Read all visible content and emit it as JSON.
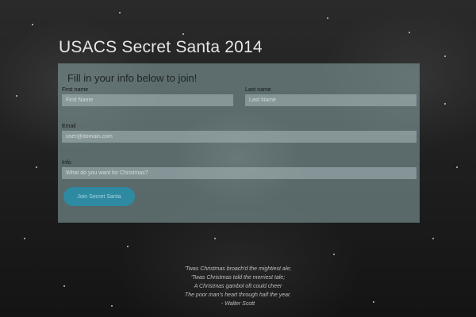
{
  "page": {
    "title": "USACS Secret Santa 2014"
  },
  "form": {
    "heading": "Fill in your info below to join!",
    "first_name": {
      "label": "First name",
      "placeholder": "First Name",
      "value": ""
    },
    "last_name": {
      "label": "Last name",
      "placeholder": "Last Name",
      "value": ""
    },
    "email": {
      "label": "Email",
      "placeholder": "user@domain.com",
      "value": ""
    },
    "info": {
      "label": "Info",
      "placeholder": "What do you want for Christmas?",
      "value": ""
    },
    "submit_label": "Join Secret Santa"
  },
  "quote": {
    "lines": [
      "'Twas Christmas broach'd the mightiest ale;",
      "'Twas Christmas told the merriest tale;",
      "A Christmas gambol oft could cheer",
      "The poor man's heart through half the year."
    ],
    "author": "- Walter Scott"
  },
  "colors": {
    "panel": "#8ca8aa",
    "button": "#2e8aa0",
    "title": "#e6e6e6"
  }
}
